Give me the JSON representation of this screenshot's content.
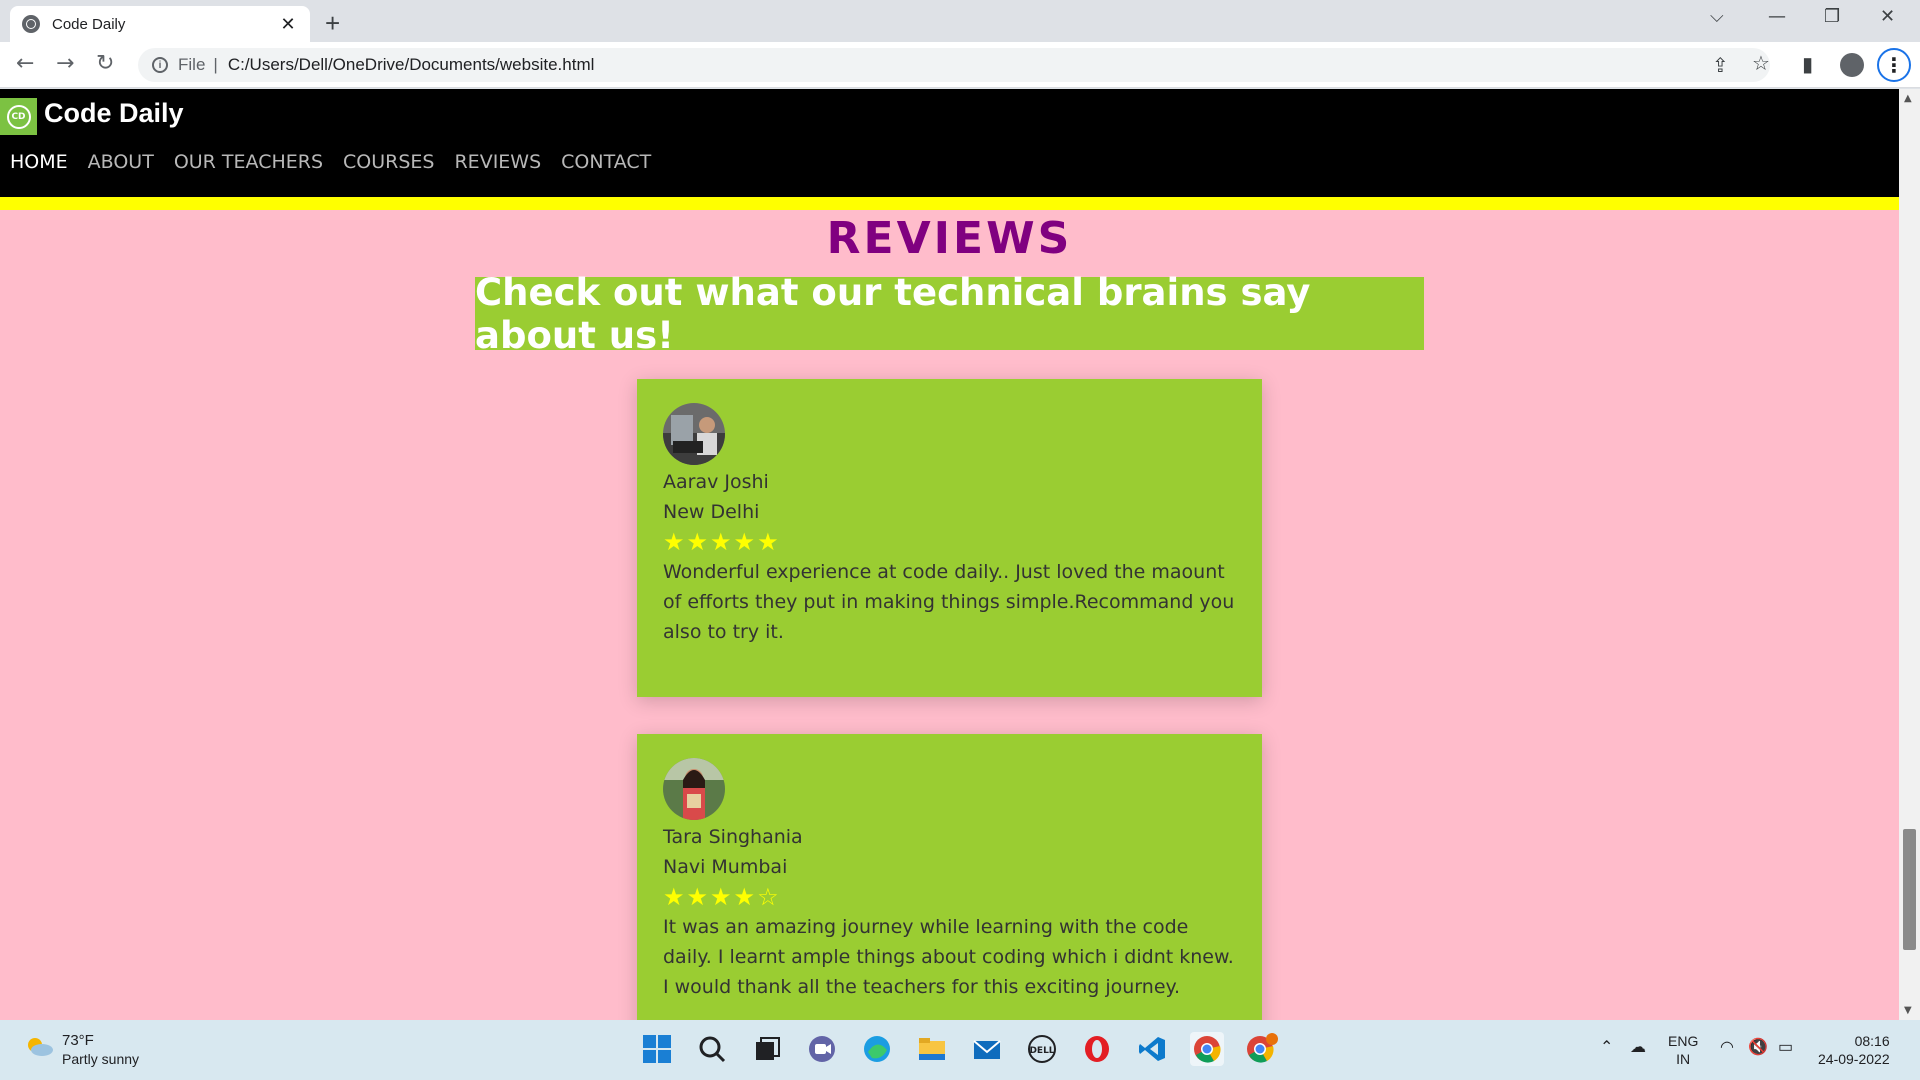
{
  "browser": {
    "tab_title": "Code Daily",
    "tab_close": "✕",
    "new_tab": "+",
    "omnibox_scheme": "File",
    "omnibox_url": "C:/Users/Dell/OneDrive/Documents/website.html"
  },
  "site": {
    "brand": "Code Daily",
    "logo_text": "CD",
    "nav": [
      "HOME",
      "ABOUT",
      "OUR TEACHERS",
      "COURSES",
      "REVIEWS",
      "CONTACT"
    ],
    "active_nav": "HOME"
  },
  "reviews": {
    "heading": "REVIEWS",
    "banner": "Check out what our technical brains say about us!",
    "items": [
      {
        "name": "Aarav Joshi",
        "city": "New Delhi",
        "rating": 5,
        "stars": "★★★★★",
        "text": "Wonderful experience at code daily.. Just loved the maount of efforts they put in making things simple.Recommand you also to try it."
      },
      {
        "name": "Tara Singhania",
        "city": "Navi Mumbai",
        "rating": 4,
        "stars": "★★★★☆",
        "text": "It was an amazing journey while learning with the code daily. I learnt ample things about coding which i didnt knew. I would thank all the teachers for this exciting journey."
      }
    ]
  },
  "taskbar": {
    "temperature": "73°F",
    "condition": "Partly sunny",
    "lang_top": "ENG",
    "lang_bottom": "IN",
    "time": "08:16",
    "date": "24-09-2022"
  },
  "colors": {
    "page_bg": "#ffbccb",
    "card_bg": "#9acd32",
    "heading": "#800080",
    "accent_bar": "#ffff00",
    "header_bg": "#000000"
  }
}
